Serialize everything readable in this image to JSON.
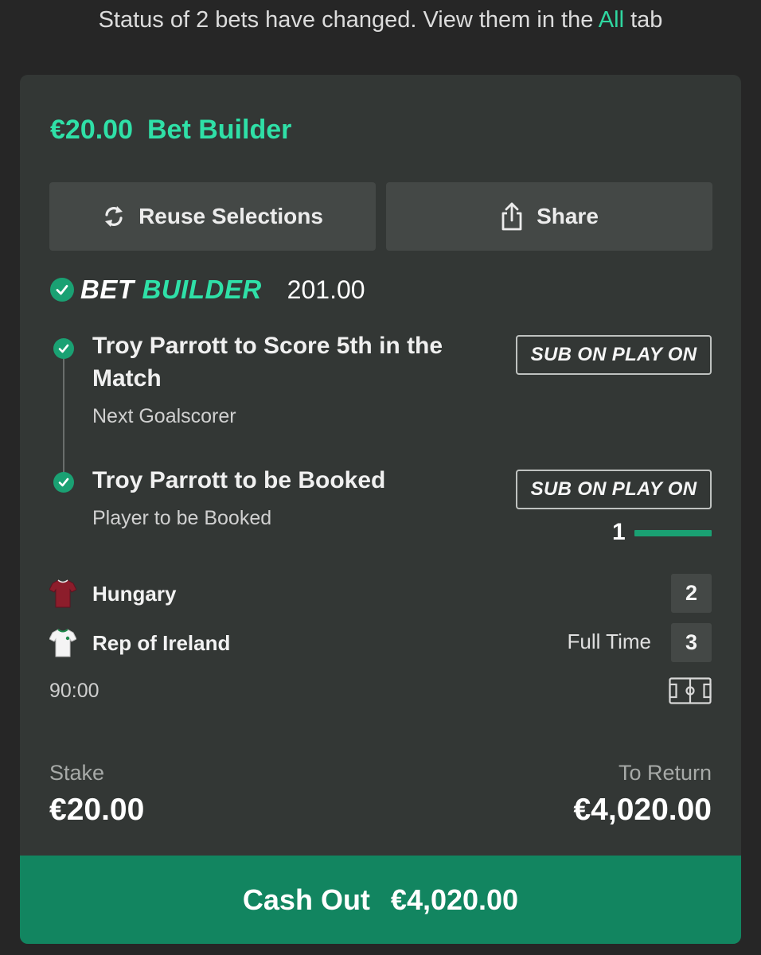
{
  "banner": {
    "text_before": "Status of 2 bets have changed. View them in the ",
    "link": "All",
    "text_after": " tab"
  },
  "bet": {
    "stake_title": "€20.00",
    "type_title": "Bet Builder",
    "reuse_label": "Reuse Selections",
    "share_label": "Share",
    "builder_word1": "BET",
    "builder_word2": "BUILDER",
    "odds": "201.00",
    "selections": [
      {
        "title": "Troy Parrott to Score 5th in the Match",
        "market": "Next Goalscorer",
        "badge": "SUB ON PLAY ON"
      },
      {
        "title": "Troy Parrott to be Booked",
        "market": "Player to be Booked",
        "badge": "SUB ON PLAY ON"
      }
    ],
    "progress": {
      "count": "1",
      "fraction": 1.0
    },
    "match": {
      "home": {
        "name": "Hungary",
        "score": "2"
      },
      "away": {
        "name": "Rep of Ireland",
        "score": "3"
      },
      "status": "Full Time",
      "clock": "90:00"
    },
    "stake_label": "Stake",
    "stake_value": "€20.00",
    "return_label": "To Return",
    "return_value": "€4,020.00",
    "cashout_label": "Cash Out",
    "cashout_value": "€4,020.00"
  },
  "colors": {
    "accent": "#2fe0a7",
    "success": "#1aa173",
    "cashout_bg": "#128560",
    "card_bg": "#333735"
  }
}
